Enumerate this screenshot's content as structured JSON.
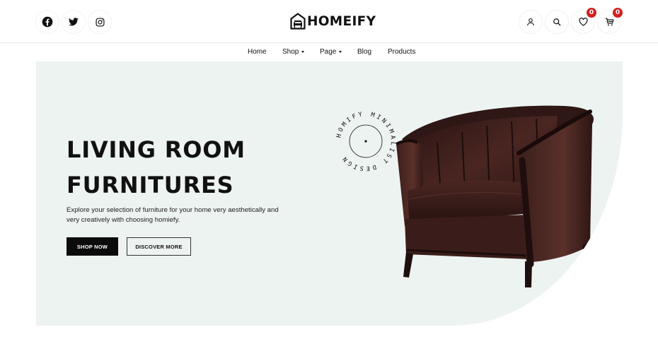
{
  "header": {
    "social": [
      {
        "name": "facebook-icon"
      },
      {
        "name": "twitter-icon"
      },
      {
        "name": "instagram-icon"
      }
    ],
    "logo_text": "HOMEIFY",
    "actions": {
      "account": {
        "icon": "user-icon"
      },
      "search": {
        "icon": "search-icon"
      },
      "wishlist": {
        "icon": "heart-icon",
        "count": "0"
      },
      "cart": {
        "icon": "cart-icon",
        "count": "0"
      }
    }
  },
  "nav": {
    "items": [
      {
        "label": "Home",
        "dropdown": false
      },
      {
        "label": "Shop",
        "dropdown": true
      },
      {
        "label": "Page",
        "dropdown": true
      },
      {
        "label": "Blog",
        "dropdown": false
      },
      {
        "label": "Products",
        "dropdown": false
      }
    ]
  },
  "hero": {
    "title_line1": "LIVING ROOM",
    "title_line2": "FURNITURES",
    "description": "Explore your selection of furniture for your home very aesthetically and very creatively with choosing homiefy.",
    "primary_button": "SHOP NOW",
    "secondary_button": "DISCOVER MORE",
    "stamp_text": "HOMIFY MINIMALIST DESIGN",
    "background": "#edf3f1"
  },
  "colors": {
    "accent": "#0b0b0b",
    "badge": "#d21f1f",
    "chair": "#3a1d1a"
  }
}
